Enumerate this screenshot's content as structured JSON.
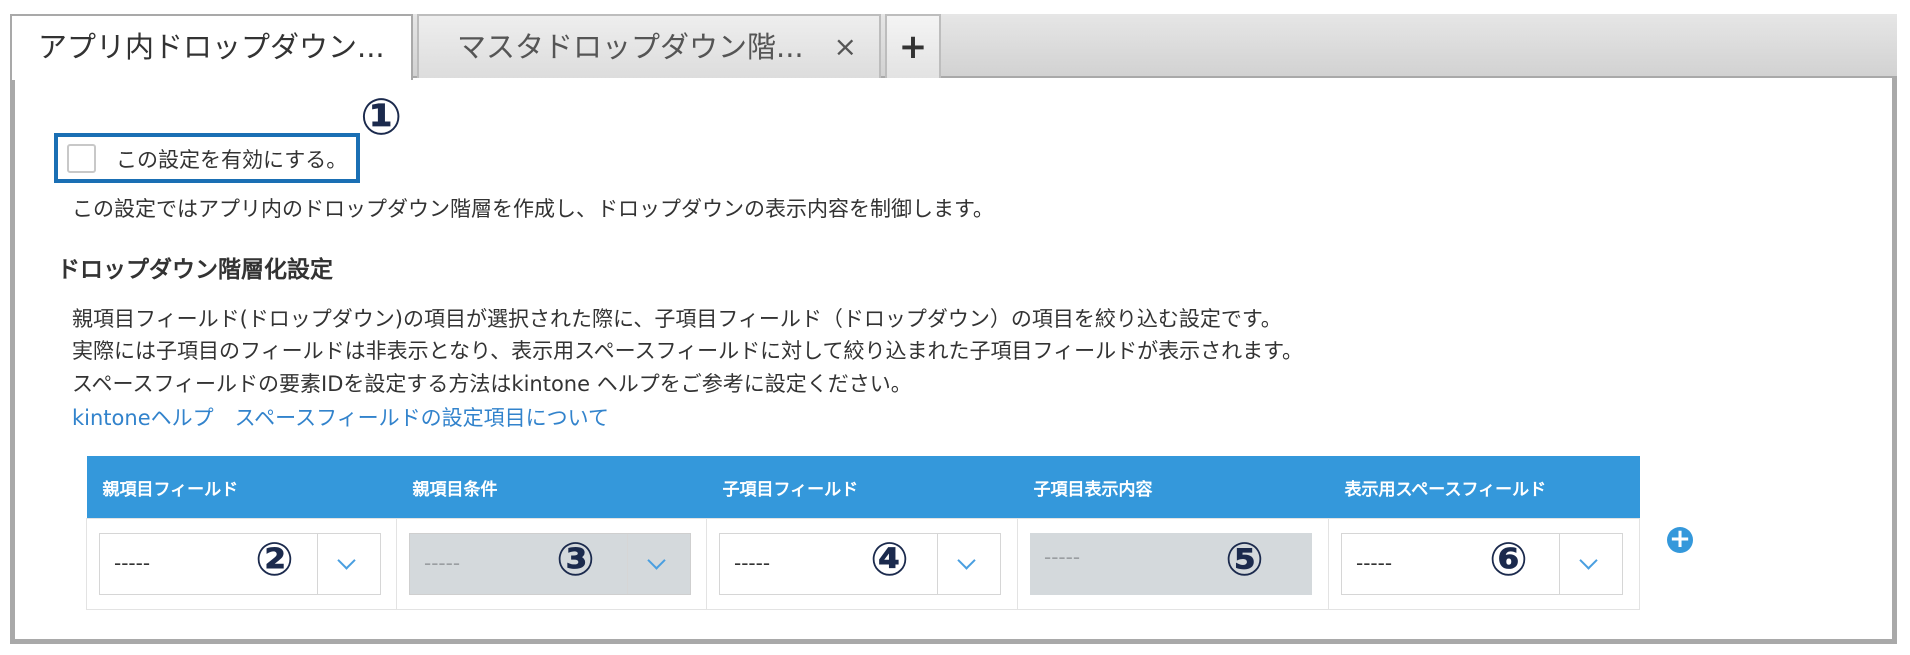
{
  "tabs": {
    "active_label": "アプリ内ドロップダウン...",
    "inactive_label": "マスタドロップダウン階...",
    "close_glyph": "×",
    "add_glyph": "+"
  },
  "callouts": [
    "①",
    "②",
    "③",
    "④",
    "⑤",
    "⑥"
  ],
  "enable": {
    "label": "この設定を有効にする。",
    "checked": false
  },
  "description": "この設定ではアプリ内のドロップダウン階層を作成し、ドロップダウンの表示内容を制御します。",
  "section": {
    "heading": "ドロップダウン階層化設定",
    "lines": [
      "親項目フィールド(ドロップダウン)の項目が選択された際に、子項目フィールド（ドロップダウン）の項目を絞り込む設定です。",
      "実際には子項目のフィールドは非表示となり、表示用スペースフィールドに対して絞り込まれた子項目フィールドが表示されます。",
      "スペースフィールドの要素IDを設定する方法はkintone ヘルプをご参考に設定ください。"
    ],
    "link": "kintoneヘルプ　スペースフィールドの設定項目について"
  },
  "table": {
    "headers": [
      "親項目フィールド",
      "親項目条件",
      "子項目フィールド",
      "子項目表示内容",
      "表示用スペースフィールド"
    ],
    "cells": [
      {
        "value": "-----",
        "disabled": false
      },
      {
        "value": "-----",
        "disabled": true
      },
      {
        "value": "-----",
        "disabled": false
      },
      {
        "value": "-----",
        "disabled": true
      },
      {
        "value": "-----",
        "disabled": false
      }
    ],
    "add_glyph": "+"
  },
  "colors": {
    "accent": "#3498db",
    "highlight_border": "#1a6fb4",
    "link": "#3283cc",
    "callout": "#1b2a4d"
  }
}
